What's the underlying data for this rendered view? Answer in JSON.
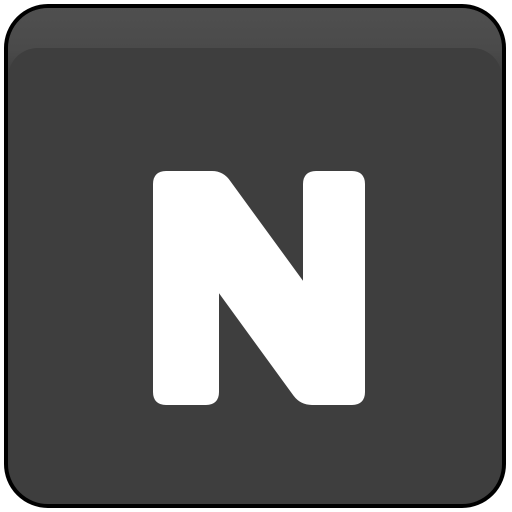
{
  "key": {
    "letter": "N",
    "background_color": "#3e3e3e",
    "border_color": "#000000",
    "letter_color": "#ffffff"
  }
}
